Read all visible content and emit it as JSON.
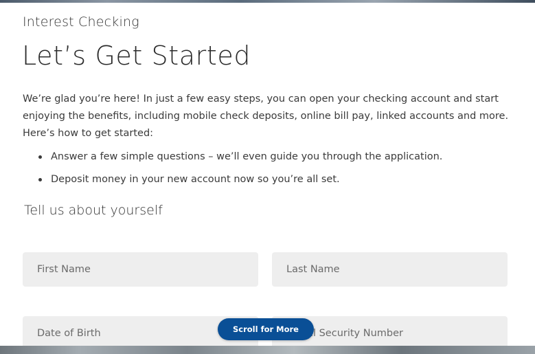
{
  "page": {
    "product_name": "Interest Checking",
    "title": "Let’s Get Started",
    "intro": "We’re glad you’re here! In just a few easy steps, you can open your checking account and start enjoying the benefits, including mobile check deposits, online bill pay, linked accounts and more. Here’s how to get started:",
    "bullets": [
      "Answer a few simple questions – we’ll even guide you through the application.",
      "Deposit money in your new account now so you’re all set."
    ],
    "section_title": "Tell us about yourself"
  },
  "form": {
    "first_name_placeholder": "First Name",
    "last_name_placeholder": "Last Name",
    "dob_placeholder": "Date of Birth",
    "ssn_placeholder": "Social Security Number"
  },
  "scroll_button": {
    "label": "Scroll for More",
    "color": "#0a4f96"
  }
}
